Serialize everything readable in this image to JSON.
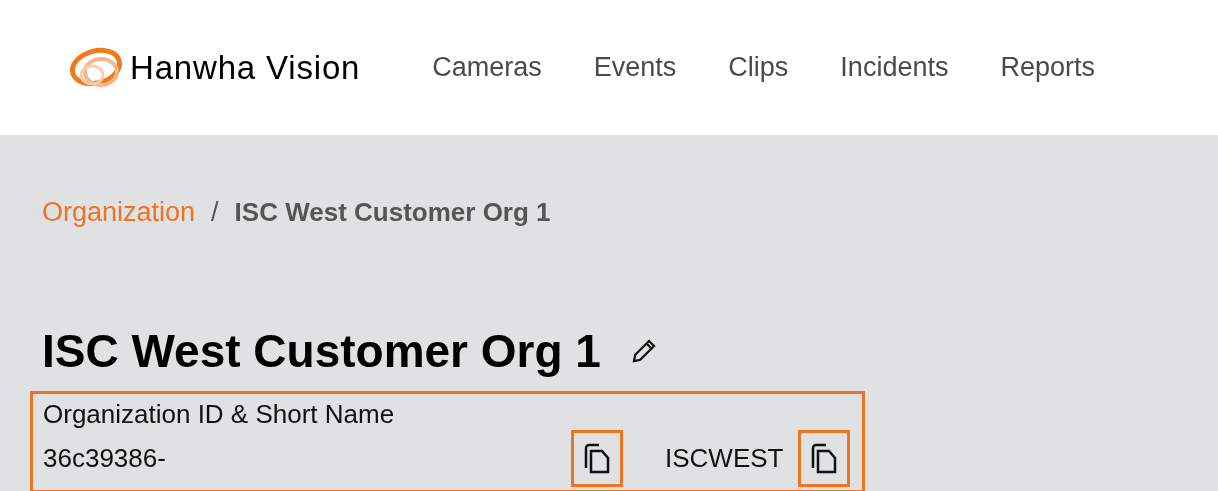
{
  "header": {
    "logo_text": "Hanwha Vision",
    "nav": [
      "Cameras",
      "Events",
      "Clips",
      "Incidents",
      "Reports"
    ]
  },
  "breadcrumb": [
    {
      "label": "Organization",
      "kind": "link"
    },
    {
      "label": "/",
      "kind": "separator"
    },
    {
      "label": "ISC West Customer Org 1",
      "kind": "current"
    }
  ],
  "title": "ISC West Customer Org 1",
  "org_info": {
    "label": "Organization ID & Short Name",
    "id": "36c39386-",
    "short_name": "ISCWEST"
  }
}
